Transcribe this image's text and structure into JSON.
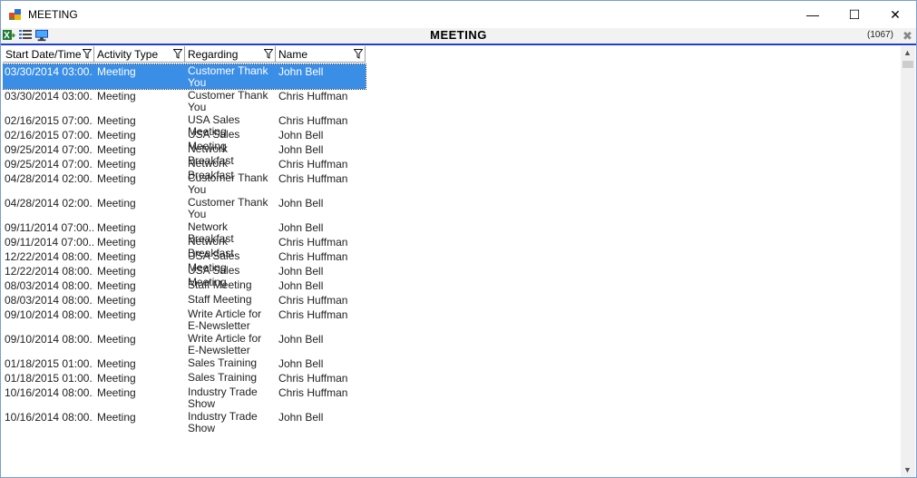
{
  "window": {
    "title": "MEETING",
    "minimize_glyph": "—",
    "maximize_glyph": "☐",
    "close_glyph": "✕"
  },
  "toolbar": {
    "title": "MEETING",
    "record_count": "(1067)",
    "close_glyph": "✖"
  },
  "icons": {
    "app": "app-window-icon",
    "export": "excel-export-icon",
    "list": "list-icon",
    "monitor": "monitor-icon"
  },
  "colors": {
    "selection": "#3a8ee6",
    "accent_line": "#1f3fcc"
  },
  "grid": {
    "columns": [
      {
        "label": "Start Date/Time"
      },
      {
        "label": "Activity Type"
      },
      {
        "label": "Regarding"
      },
      {
        "label": "Name"
      }
    ],
    "rows": [
      {
        "date": "03/30/2014  03:00...",
        "type": "Meeting",
        "regarding": "Customer Thank You",
        "name": "John Bell",
        "selected": true
      },
      {
        "date": "03/30/2014  03:00...",
        "type": "Meeting",
        "regarding": "Customer Thank You",
        "name": "Chris Huffman"
      },
      {
        "date": "02/16/2015  07:00...",
        "type": "Meeting",
        "regarding": "USA Sales Meeting",
        "name": "Chris Huffman"
      },
      {
        "date": "02/16/2015  07:00...",
        "type": "Meeting",
        "regarding": "USA Sales Meeting",
        "name": "John Bell"
      },
      {
        "date": "09/25/2014  07:00...",
        "type": "Meeting",
        "regarding": "Network Breakfast",
        "name": "John Bell"
      },
      {
        "date": "09/25/2014  07:00...",
        "type": "Meeting",
        "regarding": "Network Breakfast",
        "name": "Chris Huffman"
      },
      {
        "date": "04/28/2014  02:00...",
        "type": "Meeting",
        "regarding": "Customer Thank You",
        "name": "Chris Huffman"
      },
      {
        "date": "04/28/2014  02:00...",
        "type": "Meeting",
        "regarding": "Customer Thank You",
        "name": "John Bell"
      },
      {
        "date": "09/11/2014  07:00...",
        "type": "Meeting",
        "regarding": "Network Breakfast",
        "name": "John Bell"
      },
      {
        "date": "09/11/2014  07:00...",
        "type": "Meeting",
        "regarding": "Network Breakfast",
        "name": "Chris Huffman"
      },
      {
        "date": "12/22/2014  08:00...",
        "type": "Meeting",
        "regarding": "USA Sales Meeting",
        "name": "Chris Huffman"
      },
      {
        "date": "12/22/2014  08:00...",
        "type": "Meeting",
        "regarding": "USA Sales Meeting",
        "name": "John Bell"
      },
      {
        "date": "08/03/2014  08:00...",
        "type": "Meeting",
        "regarding": "Staff Meeting",
        "name": "John Bell"
      },
      {
        "date": "08/03/2014  08:00...",
        "type": "Meeting",
        "regarding": "Staff Meeting",
        "name": "Chris Huffman"
      },
      {
        "date": "09/10/2014  08:00...",
        "type": "Meeting",
        "regarding": "Write Article for E-Newsletter",
        "name": "Chris Huffman"
      },
      {
        "date": "09/10/2014  08:00...",
        "type": "Meeting",
        "regarding": "Write Article for E-Newsletter",
        "name": "John Bell"
      },
      {
        "date": "01/18/2015  01:00...",
        "type": "Meeting",
        "regarding": "Sales Training",
        "name": "John Bell"
      },
      {
        "date": "01/18/2015  01:00...",
        "type": "Meeting",
        "regarding": "Sales Training",
        "name": "Chris Huffman"
      },
      {
        "date": "10/16/2014  08:00...",
        "type": "Meeting",
        "regarding": "Industry Trade Show",
        "name": "Chris Huffman"
      },
      {
        "date": "10/16/2014  08:00...",
        "type": "Meeting",
        "regarding": "Industry Trade Show",
        "name": "John Bell"
      }
    ]
  },
  "scrollbar": {
    "up_glyph": "▲",
    "down_glyph": "▼"
  }
}
